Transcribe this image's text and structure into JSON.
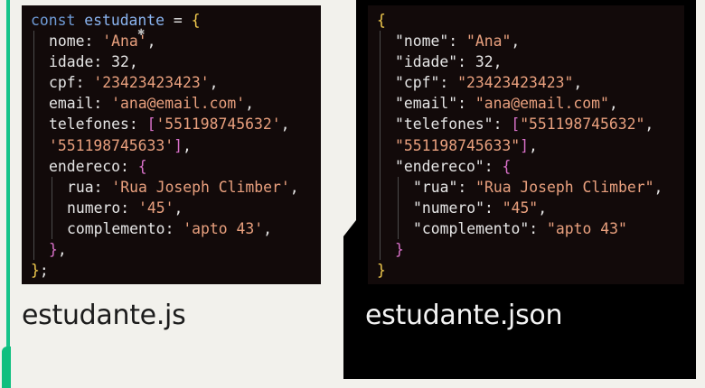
{
  "js_file": {
    "caption": "estudante.js",
    "lines": {
      "l1": {
        "kw": "const",
        "var": "estudante",
        "op": " = ",
        "brace": "{"
      },
      "nome": {
        "key": "nome",
        "sep": ": ",
        "val": "'Ana'",
        "end": ","
      },
      "idade": {
        "key": "idade",
        "sep": ": ",
        "val": "32",
        "end": ","
      },
      "cpf": {
        "key": "cpf",
        "sep": ": ",
        "val": "'23423423423'",
        "end": ","
      },
      "email": {
        "key": "email",
        "sep": ": ",
        "val": "'ana@email.com'",
        "end": ","
      },
      "telefones": {
        "key": "telefones",
        "sep": ": ",
        "open": "[",
        "val1": "'551198745632'",
        "comma": ","
      },
      "telefones2": {
        "val2": "'551198745633'",
        "close": "]",
        "end": ","
      },
      "endereco": {
        "key": "endereco",
        "sep": ": ",
        "brace": "{"
      },
      "rua": {
        "key": "rua",
        "sep": ": ",
        "val": "'Rua Joseph Climber'",
        "end": ","
      },
      "numero": {
        "key": "numero",
        "sep": ": ",
        "val": "'45'",
        "end": ","
      },
      "complemento": {
        "key": "complemento",
        "sep": ": ",
        "val": "'apto 43'",
        "end": ","
      },
      "close_inner": {
        "brace": "}",
        "end": ","
      },
      "close_outer": {
        "brace": "}",
        "end": ";"
      }
    }
  },
  "json_file": {
    "caption": "estudante.json",
    "lines": {
      "open": {
        "brace": "{"
      },
      "nome": {
        "key": "\"nome\"",
        "sep": ": ",
        "val": "\"Ana\"",
        "end": ","
      },
      "idade": {
        "key": "\"idade\"",
        "sep": ": ",
        "val": "32",
        "end": ","
      },
      "cpf": {
        "key": "\"cpf\"",
        "sep": ": ",
        "val": "\"23423423423\"",
        "end": ","
      },
      "email": {
        "key": "\"email\"",
        "sep": ": ",
        "val": "\"ana@email.com\"",
        "end": ","
      },
      "telefones": {
        "key": "\"telefones\"",
        "sep": ": ",
        "open": "[",
        "val1": "\"551198745632\"",
        "comma": ","
      },
      "telefones2": {
        "val2": "\"551198745633\"",
        "close": "]",
        "end": ","
      },
      "endereco": {
        "key": "\"endereco\"",
        "sep": ": ",
        "brace": "{"
      },
      "rua": {
        "key": "\"rua\"",
        "sep": ": ",
        "val": "\"Rua Joseph Climber\"",
        "end": ","
      },
      "numero": {
        "key": "\"numero\"",
        "sep": ": ",
        "val": "\"45\"",
        "end": ","
      },
      "complemento": {
        "key": "\"complemento\"",
        "sep": ": ",
        "val": "\"apto 43\""
      },
      "close_inner": {
        "brace": "}"
      },
      "close_outer": {
        "brace": "}"
      }
    }
  },
  "colors": {
    "keyword": "#6f9bd7",
    "string": "#e9a07e",
    "brace_outer": "#f0c94d",
    "brace_inner": "#d870c8",
    "accent_green": "#17c48a"
  },
  "icons": {
    "cursor": "mouse-cursor-icon"
  }
}
